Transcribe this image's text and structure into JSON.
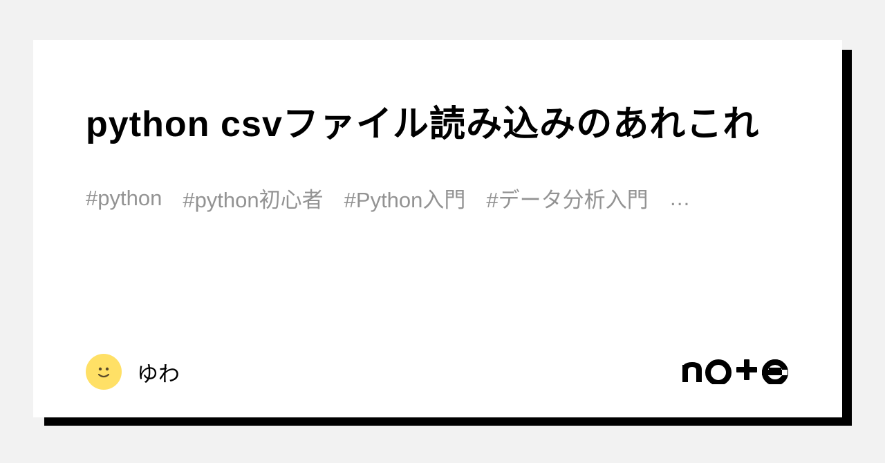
{
  "card": {
    "title": "python csvファイル読み込みのあれこれ",
    "tags": [
      "#python",
      "#python初心者",
      "#Python入門",
      "#データ分析入門"
    ],
    "more": "…",
    "author": {
      "name": "ゆわ",
      "avatar_emoji": "🙂"
    },
    "platform": "note"
  }
}
